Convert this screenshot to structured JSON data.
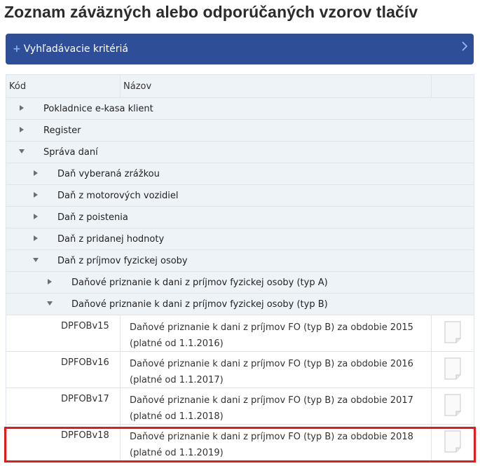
{
  "page": {
    "title": "Zoznam záväzných alebo odporúčaných vzorov tlačív"
  },
  "search": {
    "label": "Vyhľadávacie kritériá"
  },
  "table": {
    "headers": {
      "code": "Kód",
      "name": "Názov"
    },
    "tree": [
      {
        "label": "Pokladnice e-kasa klient",
        "expanded": false
      },
      {
        "label": "Register",
        "expanded": false
      },
      {
        "label": "Správa daní",
        "expanded": true
      },
      {
        "label": "Daň vyberaná zrážkou",
        "expanded": false
      },
      {
        "label": "Daň z motorových vozidiel",
        "expanded": false
      },
      {
        "label": "Daň z poistenia",
        "expanded": false
      },
      {
        "label": "Daň z pridanej hodnoty",
        "expanded": false
      },
      {
        "label": "Daň z príjmov fyzickej osoby",
        "expanded": true
      },
      {
        "label": "Daňové priznanie k dani z príjmov fyzickej osoby (typ A)",
        "expanded": false
      },
      {
        "label": "Daňové priznanie k dani z príjmov fyzickej osoby (typ B)",
        "expanded": true
      }
    ],
    "rows": [
      {
        "code": "DPFOBv15",
        "name": "Daňové priznanie k dani z príjmov FO (typ B) za obdobie 2015 (platné od 1.1.2016)"
      },
      {
        "code": "DPFOBv16",
        "name": "Daňové priznanie k dani z príjmov FO (typ B) za obdobie 2016 (platné od 1.1.2017)"
      },
      {
        "code": "DPFOBv17",
        "name": "Daňové priznanie k dani z príjmov FO (typ B) za obdobie 2017 (platné od 1.1.2018)"
      },
      {
        "code": "DPFOBv18",
        "name": "Daňové priznanie k dani z príjmov FO (typ B) za obdobie 2018 (platné od 1.1.2019)"
      }
    ]
  },
  "icons": {
    "expand": "triangle-right-icon",
    "collapse": "triangle-down-icon",
    "document": "document-icon",
    "search_toggle": "plus-icon",
    "search_arrow": "chevron-right-icon"
  },
  "colors": {
    "header_bar": "#2f4e98",
    "row_bg": "#eef3f8",
    "highlight": "#e31b1b"
  }
}
